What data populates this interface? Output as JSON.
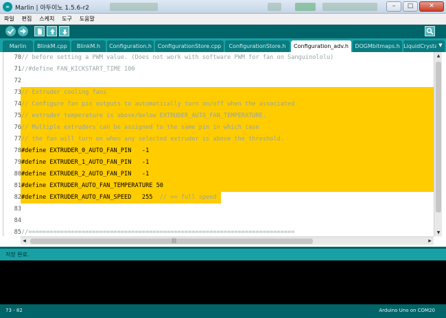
{
  "window": {
    "title": "Marlin | 아두이노 1.5.6-r2",
    "app_icon": "arduino-logo-icon",
    "logo_text": "∞"
  },
  "menu": [
    "파일",
    "편집",
    "스케치",
    "도구",
    "도움말"
  ],
  "toolbar": {
    "buttons": [
      "verify-icon",
      "upload-icon",
      "new-icon",
      "open-icon",
      "save-icon"
    ],
    "serial_monitor": "serial-monitor-icon"
  },
  "tabs": [
    {
      "label": "Marlin"
    },
    {
      "label": "BlinkM.cpp"
    },
    {
      "label": "BlinkM.h"
    },
    {
      "label": "Configuration.h"
    },
    {
      "label": "ConfigurationStore.cpp"
    },
    {
      "label": "ConfigurationStore.h"
    },
    {
      "label": "Configuration_adv.h",
      "active": true
    },
    {
      "label": "DOGMbitmaps.h"
    },
    {
      "label": "LiquidCrystal..."
    }
  ],
  "editor": {
    "lines": [
      {
        "n": "70",
        "text": "// before setting a PWM value. (Does not work with software PWM for fan on Sanguinololu)",
        "kind": "cmt",
        "hl": false
      },
      {
        "n": "71",
        "text": "//#define FAN_KICKSTART_TIME 100",
        "kind": "cmt",
        "hl": false
      },
      {
        "n": "72",
        "text": "",
        "kind": "plain",
        "hl": false
      },
      {
        "n": "73",
        "text": "// Extruder cooling fans",
        "kind": "cmt",
        "hl": true
      },
      {
        "n": "74",
        "text": "// Configure fan pin outputs to automatically turn on/off when the associated",
        "kind": "cmt",
        "hl": true
      },
      {
        "n": "75",
        "text": "// extruder temperature is above/below EXTRUDER_AUTO_FAN_TEMPERATURE.",
        "kind": "cmt",
        "hl": true
      },
      {
        "n": "76",
        "text": "// Multiple extruders can be assigned to the same pin in which case",
        "kind": "cmt",
        "hl": true
      },
      {
        "n": "77",
        "text": "// the fan will turn on when any selected extruder is above the threshold.",
        "kind": "cmt",
        "hl": true
      },
      {
        "n": "78",
        "text": "#define EXTRUDER_0_AUTO_FAN_PIN   -1",
        "kind": "plain",
        "hl": true
      },
      {
        "n": "79",
        "text": "#define EXTRUDER_1_AUTO_FAN_PIN   -1",
        "kind": "plain",
        "hl": true
      },
      {
        "n": "80",
        "text": "#define EXTRUDER_2_AUTO_FAN_PIN   -1",
        "kind": "plain",
        "hl": true
      },
      {
        "n": "81",
        "text": "#define EXTRUDER_AUTO_FAN_TEMPERATURE 50",
        "kind": "plain",
        "hl": true
      },
      {
        "n": "82",
        "text": "#define EXTRUDER_AUTO_FAN_SPEED   255",
        "comment": "  // == full speed",
        "kind": "plain",
        "hl": "partial"
      },
      {
        "n": "83",
        "text": "",
        "kind": "plain",
        "hl": false
      },
      {
        "n": "84",
        "text": "",
        "kind": "plain",
        "hl": false
      },
      {
        "n": "85",
        "text": "//===========================================================================",
        "kind": "cmt",
        "hl": false
      }
    ]
  },
  "status": {
    "message": "저장 완료."
  },
  "footer": {
    "cursor": "73 - 82",
    "board": "Arduino Uno on COM20"
  },
  "colors": {
    "toolbar": "#006468",
    "tabs": "#17a1a5",
    "highlight": "#ffcc00",
    "comment": "#95a5a6"
  }
}
